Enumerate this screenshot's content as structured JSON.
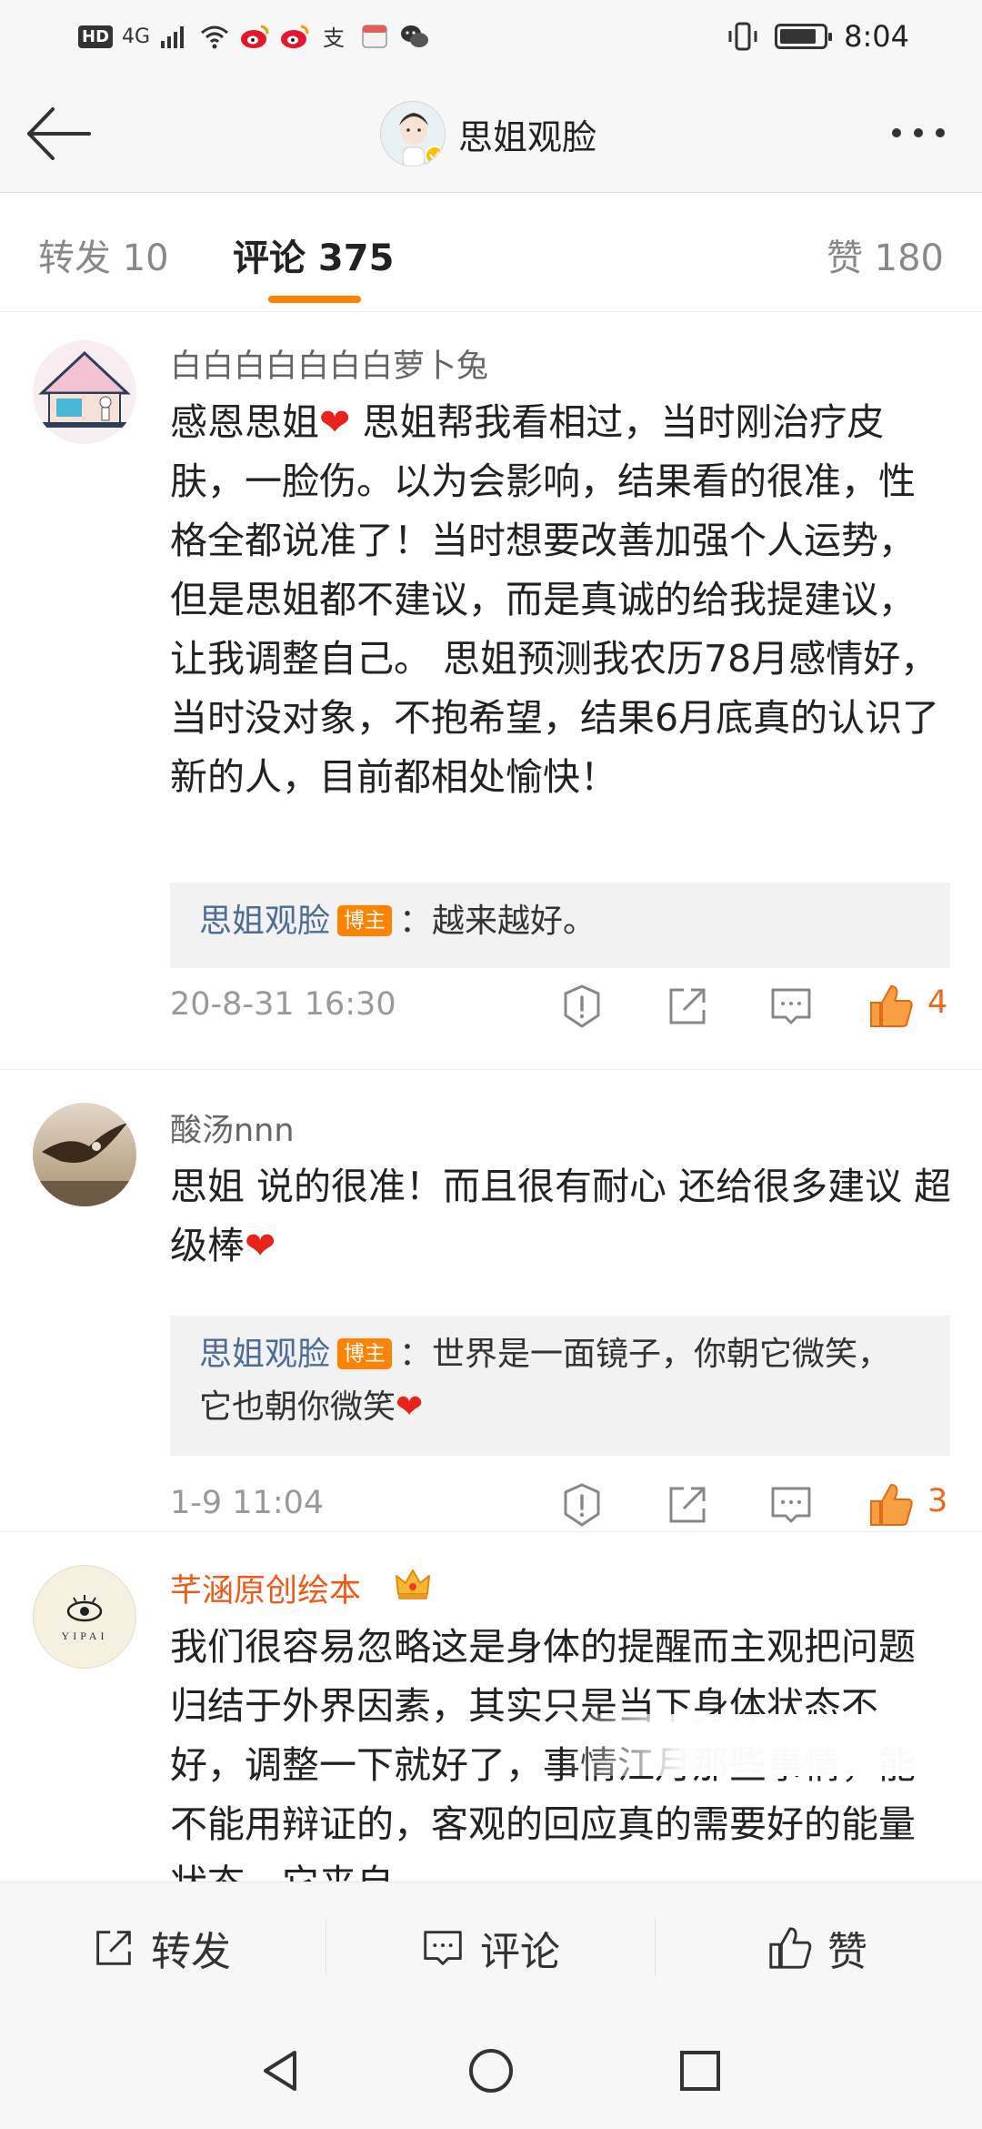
{
  "status_bar": {
    "network_label": "HD",
    "signal_label": "4G",
    "time": "8:04",
    "battery_level": 0.85,
    "notification_icons": [
      "weibo-icon",
      "weibo-icon",
      "alipay-icon",
      "app-icon",
      "wechat-icon"
    ]
  },
  "header": {
    "title": "思姐观脸"
  },
  "tabs": {
    "repost": "转发 10",
    "comment": "评论 375",
    "like": "赞 180"
  },
  "comments": [
    {
      "username": "白白白白白白白萝卜兔",
      "text": "感恩思姐",
      "text_after_heart": " 思姐帮我看相过，当时刚治疗皮肤，一脸伤。以为会影响，结果看的很准，性格全都说准了！当时想要改善加强个人运势，但是思姐都不建议，而是真诚的给我提建议，让我调整自己。 思姐预测我农历78月感情好，当时没对象，不抱希望，结果6月底真的认识了新的人，目前都相处愉快！",
      "reply": {
        "author": "思姐观脸",
        "badge": "博主",
        "text": "：越来越好。"
      },
      "time": "20-8-31 16:30",
      "likes": "4"
    },
    {
      "username": "酸汤nnn",
      "text": "思姐 说的很准！而且很有耐心 还给很多建议 超级棒",
      "reply": {
        "author": "思姐观脸",
        "badge": "博主",
        "text": "：世界是一面镜子，你朝它微笑，它也朝你微笑"
      },
      "time": "1-9 11:04",
      "likes": "3"
    },
    {
      "username": "芊涵原创绘本",
      "avatar_text": "YIPAI",
      "text": "我们很容易忽略这是身体的提醒而主观把问题归结于外界因素，其实只是当下身体状态不好，调整一下就好了，事情江月那些事情，能不能用辩证的，客观的回应真的需要好的能量状态，它来自"
    }
  ],
  "bottom_bar": {
    "repost": "转发",
    "comment": "评论",
    "like": "赞"
  },
  "colors": {
    "accent": "#ff8200",
    "like": "#f06a1a",
    "reply_name": "#4b6d96",
    "vip_name": "#f05a18"
  }
}
